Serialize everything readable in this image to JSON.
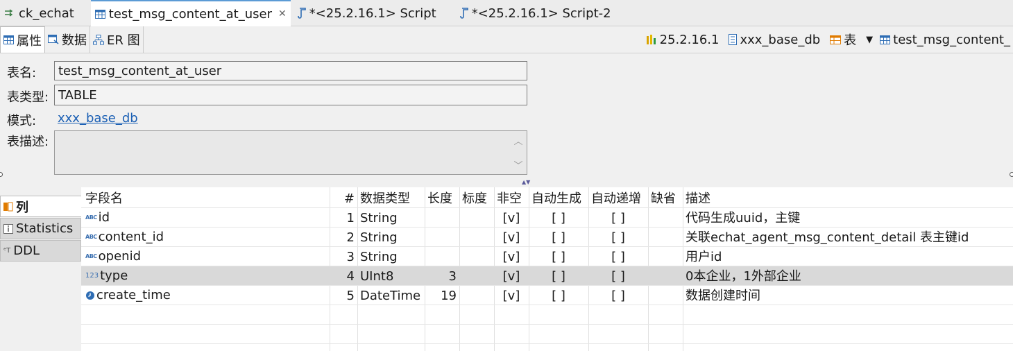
{
  "tabs": [
    {
      "label": "ck_echat",
      "icon": "connection-icon",
      "active": false
    },
    {
      "label": "test_msg_content_at_user",
      "icon": "table-icon",
      "active": true,
      "closable": true
    },
    {
      "label": "*<25.2.16.1> Script",
      "icon": "script-icon",
      "active": false
    },
    {
      "label": "*<25.2.16.1> Script-2",
      "icon": "script-icon",
      "active": false
    }
  ],
  "subtabs": [
    {
      "label": "属性",
      "icon": "table-icon",
      "active": true
    },
    {
      "label": "数据",
      "icon": "data-icon",
      "active": false
    },
    {
      "label": "ER 图",
      "icon": "er-diagram-icon",
      "active": false
    }
  ],
  "breadcrumb": {
    "server": "25.2.16.1",
    "database": "xxx_base_db",
    "type": "表",
    "table": "test_msg_content_"
  },
  "properties": {
    "name_label": "表名:",
    "name_value": "test_msg_content_at_user",
    "type_label": "表类型:",
    "type_value": "TABLE",
    "schema_label": "模式:",
    "schema_value": "xxx_base_db",
    "desc_label": "表描述:",
    "desc_value": ""
  },
  "side_tabs": [
    {
      "label": "列",
      "icon": "columns-icon",
      "active": true
    },
    {
      "label": "Statistics",
      "icon": "info-icon",
      "active": false
    },
    {
      "label": "DDL",
      "icon": "ddl-icon",
      "active": false
    }
  ],
  "columns_table": {
    "headers": [
      "字段名",
      "#",
      "数据类型",
      "长度",
      "标度",
      "非空",
      "自动生成",
      "自动递增",
      "缺省",
      "描述"
    ],
    "rows": [
      {
        "type_icon": "abc",
        "name": "id",
        "num": "1",
        "datatype": "String",
        "length": "",
        "scale": "",
        "notnull": "[v]",
        "autogen": "[ ]",
        "autoinc": "[ ]",
        "default": "",
        "desc": "代码生成uuid，主键"
      },
      {
        "type_icon": "abc",
        "name": "content_id",
        "num": "2",
        "datatype": "String",
        "length": "",
        "scale": "",
        "notnull": "[v]",
        "autogen": "[ ]",
        "autoinc": "[ ]",
        "default": "",
        "desc": "关联echat_agent_msg_content_detail 表主键id"
      },
      {
        "type_icon": "abc",
        "name": "openid",
        "num": "3",
        "datatype": "String",
        "length": "",
        "scale": "",
        "notnull": "[v]",
        "autogen": "[ ]",
        "autoinc": "[ ]",
        "default": "",
        "desc": "用户id"
      },
      {
        "type_icon": "123",
        "name": "type",
        "num": "4",
        "datatype": "UInt8",
        "length": "3",
        "scale": "",
        "notnull": "[v]",
        "autogen": "[ ]",
        "autoinc": "[ ]",
        "default": "",
        "desc": "0本企业，1外部企业",
        "selected": true
      },
      {
        "type_icon": "clock",
        "name": "create_time",
        "num": "5",
        "datatype": "DateTime",
        "length": "19",
        "scale": "",
        "notnull": "[v]",
        "autogen": "[ ]",
        "autoinc": "[ ]",
        "default": "",
        "desc": "数据创建时间"
      }
    ]
  },
  "colors": {
    "accent": "#5b9bd5",
    "link": "#1a5fb4",
    "selected_row": "#d9d9d9"
  }
}
